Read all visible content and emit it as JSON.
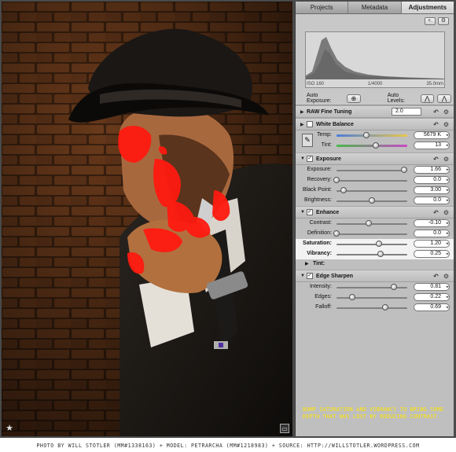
{
  "tabs": [
    {
      "label": "Projects"
    },
    {
      "label": "Metadata"
    },
    {
      "label": "Adjustments"
    }
  ],
  "histogram": {
    "tools_add": "+.",
    "tools_gear": "⚙",
    "exif": [
      "ISO 160",
      "1/4000",
      "35.0mm"
    ],
    "auto_exposure_label": "Auto Exposure:",
    "auto_levels_label": "Auto Levels:"
  },
  "raw_fine_tuning": {
    "label": "RAW Fine Tuning",
    "value": "2.0"
  },
  "white_balance": {
    "label": "White Balance",
    "sliders": [
      {
        "label": "Temp:",
        "value": "5679 K",
        "level": 0.42
      },
      {
        "label": "Tint:",
        "value": "13",
        "level": 0.55
      }
    ]
  },
  "exposure": {
    "label": "Exposure",
    "sliders": [
      {
        "label": "Exposure:",
        "value": "1.66",
        "level": 0.96
      },
      {
        "label": "Recovery:",
        "value": "0.0",
        "level": 0.0
      },
      {
        "label": "Black Point:",
        "value": "3.00",
        "level": 0.1
      },
      {
        "label": "Brightness:",
        "value": "0.0",
        "level": 0.5
      }
    ]
  },
  "enhance": {
    "label": "Enhance",
    "sliders": [
      {
        "label": "Contrast:",
        "value": "-0.10",
        "level": 0.45
      },
      {
        "label": "Definition:",
        "value": "0.0",
        "level": 0.0
      },
      {
        "label": "Saturation:",
        "value": "1.20",
        "level": 0.6
      },
      {
        "label": "Vibrancy:",
        "value": "0.25",
        "level": 0.62
      }
    ],
    "tint_label": "Tint:"
  },
  "edge_sharpen": {
    "label": "Edge Sharpen",
    "sliders": [
      {
        "label": "Intensity:",
        "value": "0.81",
        "level": 0.81
      },
      {
        "label": "Edges:",
        "value": "0.22",
        "level": 0.22
      },
      {
        "label": "Falloff:",
        "value": "0.69",
        "level": 0.69
      }
    ]
  },
  "caption": "BUMP SATURATION AND VIBRANCY TO BRING SOME DEPTH THAT WAS LOST BY REDUCING CONTRAST.",
  "credit": "PHOTO BY WILL STOTLER (MM#1338163)  +  MODEL: PETRARCHA (MM#1218983)  +  SOURCE: HTTP://WILLSTOTLER.WORDPRESS.COM"
}
